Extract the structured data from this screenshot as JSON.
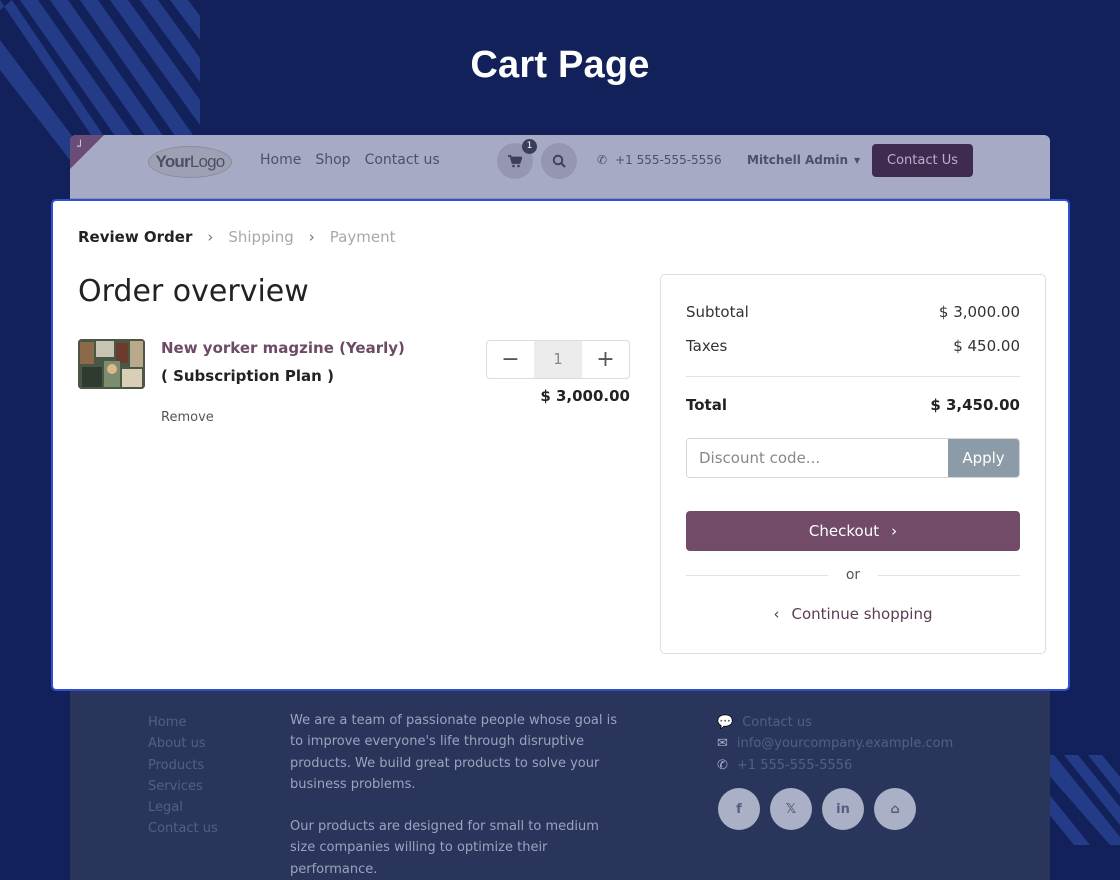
{
  "banner": {
    "title": "Cart Page"
  },
  "header": {
    "logo_text_bold": "Your",
    "logo_text_light": "Logo",
    "nav": [
      "Home",
      "Shop",
      "Contact us"
    ],
    "cart_count": "1",
    "phone": "+1 555-555-5556",
    "user": "Mitchell Admin",
    "contact_button": "Contact Us"
  },
  "steps": {
    "review": "Review Order",
    "shipping": "Shipping",
    "payment": "Payment"
  },
  "order": {
    "heading": "Order overview",
    "item": {
      "name": "New yorker magzine (Yearly)",
      "plan": "( Subscription Plan )",
      "remove": "Remove",
      "quantity": "1",
      "price": "$ 3,000.00"
    }
  },
  "summary": {
    "subtotal_label": "Subtotal",
    "subtotal_value": "$ 3,000.00",
    "taxes_label": "Taxes",
    "taxes_value": "$ 450.00",
    "total_label": "Total",
    "total_value": "$ 3,450.00",
    "discount_placeholder": "Discount code...",
    "apply_label": "Apply",
    "checkout_label": "Checkout",
    "or_label": "or",
    "continue_label": "Continue shopping"
  },
  "footer": {
    "links": [
      "Home",
      "About us",
      "Products",
      "Services",
      "Legal",
      "Contact us"
    ],
    "about_1": "We are a team of passionate people whose goal is to improve everyone's life through disruptive products. We build great products to solve your business problems.",
    "about_2": "Our products are designed for small to medium size companies willing to optimize their performance.",
    "contact_label": "Contact us",
    "email": "info@yourcompany.example.com",
    "phone": "+1 555-555-5556",
    "socials": [
      "facebook-icon",
      "x-icon",
      "linkedin-icon",
      "home-icon"
    ]
  },
  "colors": {
    "background": "#12215a",
    "brand": "#714b67",
    "highlight_border": "#2f4fd4",
    "apply_button": "#8c9ba8"
  }
}
